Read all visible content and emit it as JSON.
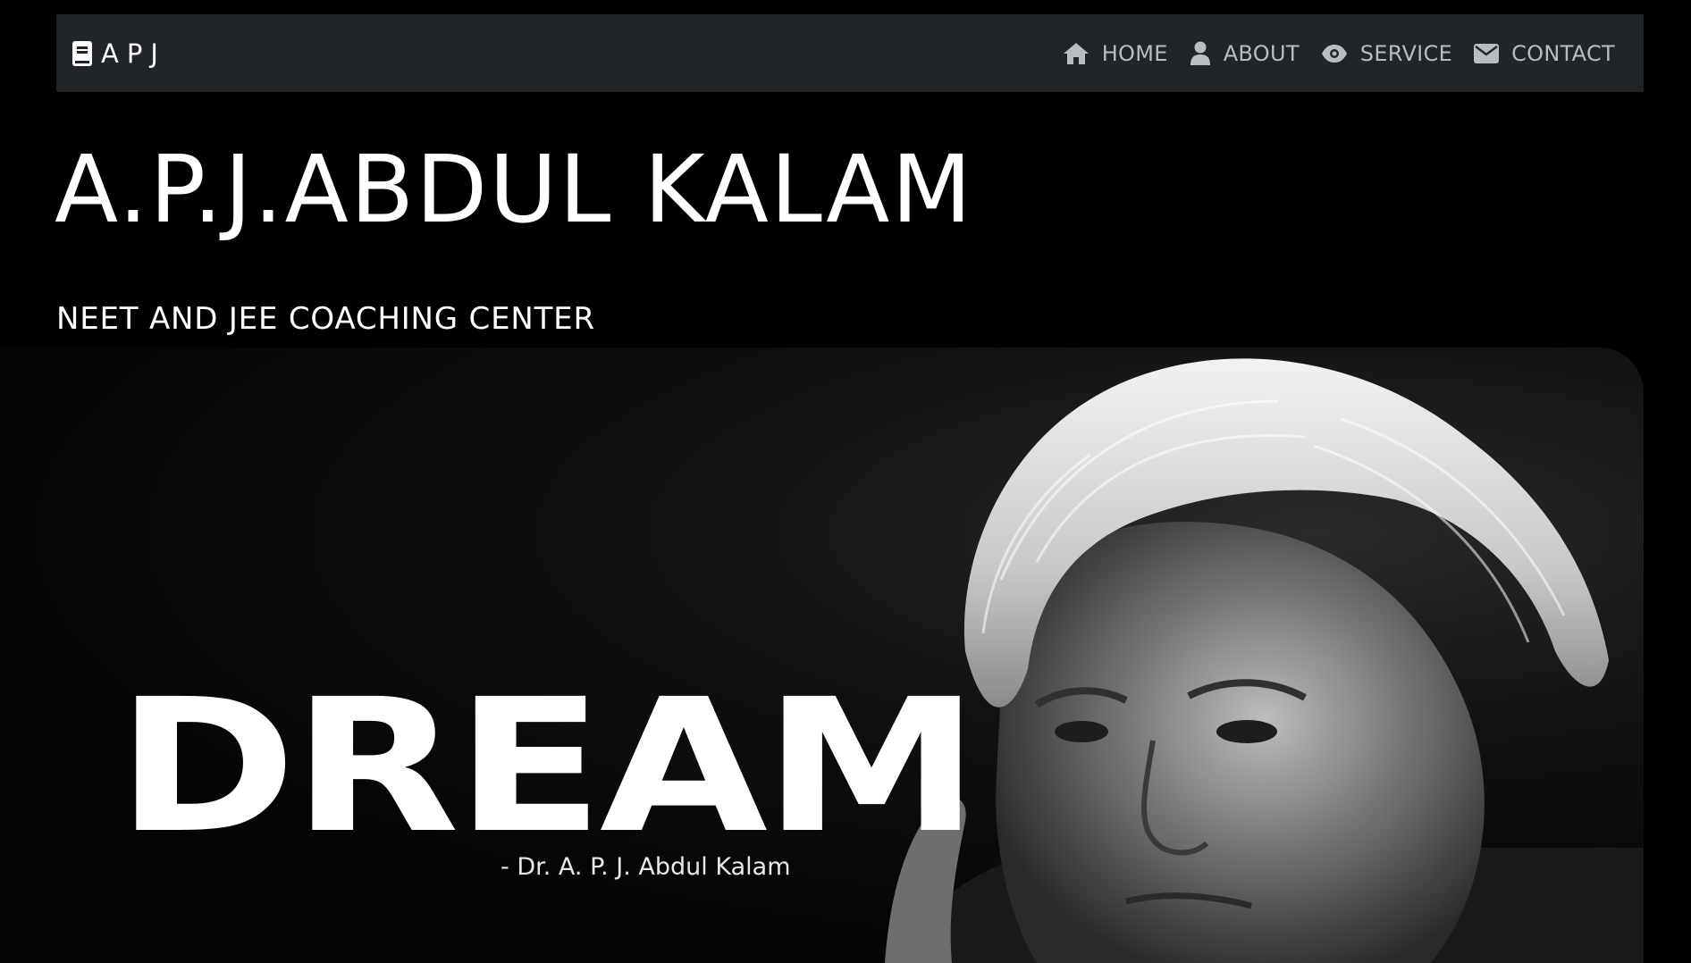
{
  "navbar": {
    "brand": "APJ",
    "brand_icon": "book-icon",
    "links": [
      {
        "label": "HOME",
        "icon": "home-icon"
      },
      {
        "label": "ABOUT",
        "icon": "user-icon"
      },
      {
        "label": "SERVICE",
        "icon": "eye-icon"
      },
      {
        "label": "CONTACT",
        "icon": "envelope-icon"
      }
    ]
  },
  "hero": {
    "title": "A.P.J.ABDUL KALAM",
    "subtitle": "NEET AND JEE COACHING CENTER",
    "image": {
      "quote": "DREAM",
      "author": "- Dr. A. P. J. Abdul Kalam"
    }
  },
  "colors": {
    "page_background": "#000000",
    "navbar_background": "#212529",
    "nav_link": "#b9bcc0",
    "text": "#ffffff"
  }
}
